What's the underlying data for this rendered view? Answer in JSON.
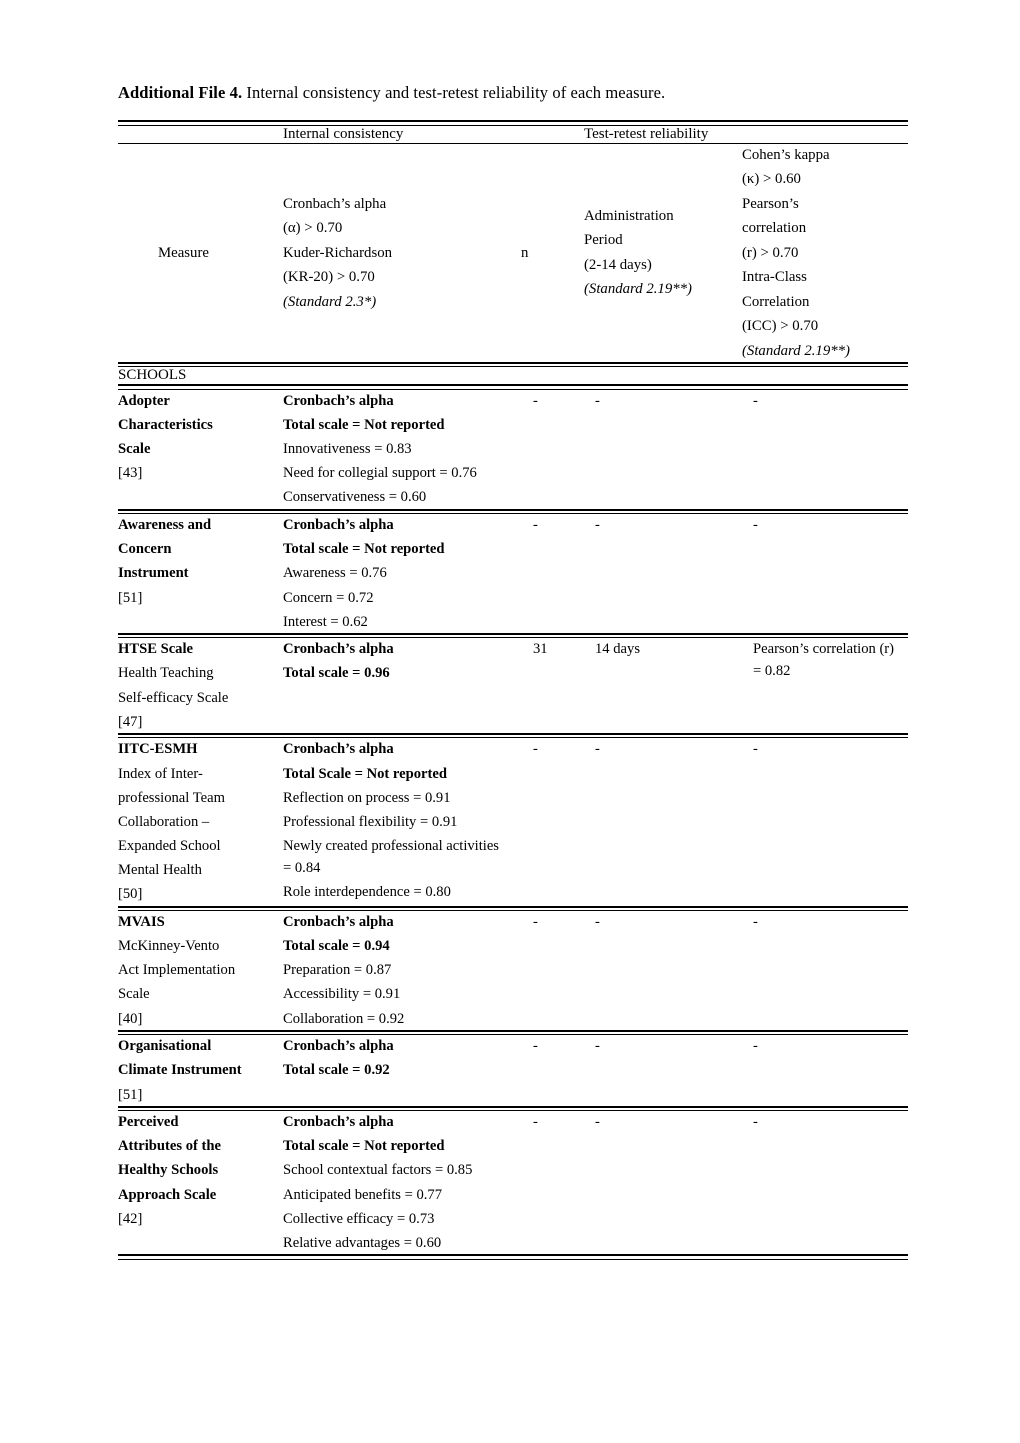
{
  "caption": {
    "lead": "Additional File 4.",
    "rest": " Internal consistency and test-retest reliability of each measure."
  },
  "table": {
    "group_headers": {
      "internal_consistency": "Internal consistency",
      "test_retest": "Test-retest reliability"
    },
    "columns": {
      "measure": "Measure",
      "alpha": {
        "l1": "Cronbach’s alpha",
        "l2": "(α) > 0.70",
        "l3": "Kuder-Richardson",
        "l4": "(KR-20) > 0.70",
        "l5": "(Standard 2.3*)"
      },
      "n": "n",
      "admin": {
        "l1": "Administration",
        "l2": "Period",
        "l3": "(2-14 days)",
        "l4": "(Standard 2.19**)"
      },
      "retest": {
        "l1": "Cohen’s kappa",
        "l2": "(κ) > 0.60",
        "l3": "Pearson’s",
        "l4": "correlation",
        "l5": "(r) > 0.70",
        "l6": "Intra-Class",
        "l7": "Correlation",
        "l8": "(ICC) > 0.70",
        "l9": "(Standard 2.19**)"
      }
    },
    "section": "SCHOOLS",
    "rows": [
      {
        "measure_bold": [
          "Adopter",
          "Characteristics",
          "Scale"
        ],
        "measure_plain": [],
        "measure_ref": "[43]",
        "alpha_bold": [
          "Cronbach’s alpha",
          "Total scale = Not reported"
        ],
        "alpha_plain": [
          "Innovativeness = 0.83",
          "Need for collegial support = 0.76",
          "Conservativeness = 0.60"
        ],
        "n": "-",
        "admin": "-",
        "retest": [
          "-"
        ]
      },
      {
        "measure_bold": [
          "Awareness and",
          "Concern",
          "Instrument"
        ],
        "measure_plain": [],
        "measure_ref": "[51]",
        "alpha_bold": [
          "Cronbach’s alpha",
          "Total scale = Not reported"
        ],
        "alpha_plain": [
          "Awareness = 0.76",
          "Concern = 0.72",
          "Interest = 0.62"
        ],
        "n": "-",
        "admin": "-",
        "retest": [
          "-"
        ]
      },
      {
        "measure_bold": [
          "HTSE Scale"
        ],
        "measure_plain": [
          "Health Teaching",
          "Self-efficacy Scale"
        ],
        "measure_ref": "[47]",
        "alpha_bold": [
          "Cronbach’s alpha",
          "Total scale = 0.96"
        ],
        "alpha_plain": [],
        "n": "31",
        "admin": "14 days",
        "retest": [
          "Pearson’s correlation (r) = 0.82"
        ]
      },
      {
        "measure_bold": [
          "IITC-ESMH"
        ],
        "measure_plain": [
          "Index of Inter-",
          "professional Team",
          "Collaboration –",
          "Expanded School",
          "Mental Health"
        ],
        "measure_ref": "[50]",
        "alpha_bold": [
          "Cronbach’s alpha",
          "Total Scale = Not reported"
        ],
        "alpha_plain": [
          "Reflection on process = 0.91",
          "Professional flexibility = 0.91",
          "Newly created professional activities = 0.84",
          "Role interdependence = 0.80"
        ],
        "n": "-",
        "admin": "-",
        "retest": [
          "-"
        ]
      },
      {
        "measure_bold": [
          "MVAIS"
        ],
        "measure_plain": [
          "McKinney-Vento",
          "Act Implementation",
          "Scale"
        ],
        "measure_ref": "[40]",
        "alpha_bold": [
          "Cronbach’s alpha",
          "Total scale = 0.94"
        ],
        "alpha_plain": [
          "Preparation = 0.87",
          "Accessibility = 0.91",
          "Collaboration = 0.92"
        ],
        "n": "-",
        "admin": "-",
        "retest": [
          "-"
        ]
      },
      {
        "measure_bold": [
          "Organisational",
          "Climate Instrument"
        ],
        "measure_plain": [],
        "measure_ref": "[51]",
        "alpha_bold": [
          "Cronbach’s alpha",
          "Total scale = 0.92"
        ],
        "alpha_plain": [],
        "n": "-",
        "admin": "-",
        "retest": [
          "-"
        ]
      },
      {
        "measure_bold": [
          "Perceived",
          "Attributes of the",
          "Healthy Schools",
          "Approach Scale"
        ],
        "measure_plain": [],
        "measure_ref": "[42]",
        "alpha_bold": [
          "Cronbach’s alpha",
          "Total scale = Not reported"
        ],
        "alpha_plain": [
          "School contextual factors = 0.85",
          "Anticipated benefits = 0.77",
          "Collective efficacy = 0.73",
          "Relative advantages = 0.60"
        ],
        "n": "-",
        "admin": "-",
        "retest": [
          "-"
        ]
      }
    ]
  }
}
